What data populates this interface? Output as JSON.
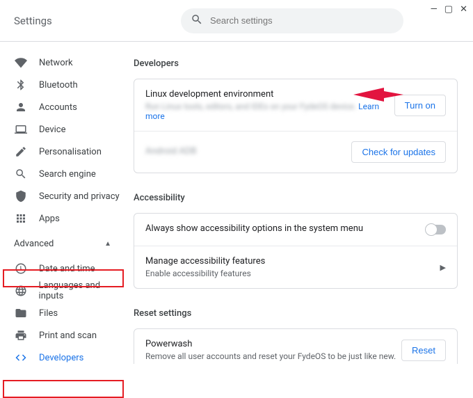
{
  "window": {
    "title": "Settings"
  },
  "search": {
    "placeholder": "Search settings"
  },
  "sidebar": {
    "top_items": [
      {
        "label": "Network"
      },
      {
        "label": "Bluetooth"
      },
      {
        "label": "Accounts"
      },
      {
        "label": "Device"
      },
      {
        "label": "Personalisation"
      },
      {
        "label": "Search engine"
      },
      {
        "label": "Security and privacy"
      },
      {
        "label": "Apps"
      }
    ],
    "advanced_label": "Advanced",
    "advanced_items": [
      {
        "label": "Date and time"
      },
      {
        "label": "Languages and inputs"
      },
      {
        "label": "Files"
      },
      {
        "label": "Print and scan"
      },
      {
        "label": "Developers"
      }
    ]
  },
  "main": {
    "sections": {
      "developers": {
        "title": "Developers",
        "rows": [
          {
            "primary": "Linux development environment",
            "secondary_blur": "Run Linux tools, editors, and IDEs on your FydeOS device.",
            "secondary_link": "Learn more",
            "button": "Turn on"
          },
          {
            "primary_blur": "Android ADB",
            "button": "Check for updates"
          }
        ]
      },
      "accessibility": {
        "title": "Accessibility",
        "rows": [
          {
            "primary": "Always show accessibility options in the system menu"
          },
          {
            "primary": "Manage accessibility features",
            "secondary": "Enable accessibility features"
          }
        ]
      },
      "reset": {
        "title": "Reset settings",
        "rows": [
          {
            "primary": "Powerwash",
            "secondary": "Remove all user accounts and reset your FydeOS to be just like new.",
            "button": "Reset"
          }
        ]
      }
    }
  }
}
